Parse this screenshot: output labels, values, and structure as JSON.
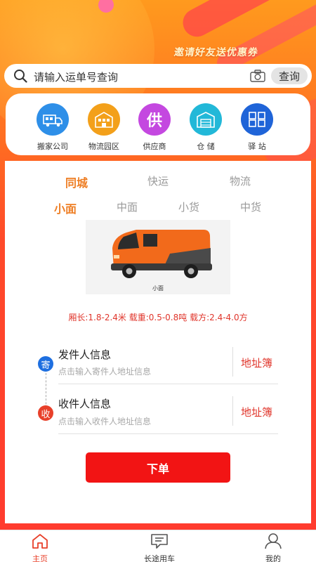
{
  "promo": {
    "text": "邀请好友送优惠券"
  },
  "search": {
    "placeholder": "请输入运单号查询",
    "button": "查询"
  },
  "categories": [
    {
      "label": "搬家公司",
      "icon": "moving-truck-icon",
      "color": "#2e8fe8"
    },
    {
      "label": "物流园区",
      "icon": "warehouse-building-icon",
      "color": "#f3a01a"
    },
    {
      "label": "供应商",
      "icon": "supplier-icon",
      "color": "#c448e0"
    },
    {
      "label": "仓 储",
      "icon": "storage-icon",
      "color": "#22b8d8"
    },
    {
      "label": "驿 站",
      "icon": "station-icon",
      "color": "#1f64d8"
    }
  ],
  "service_tabs": [
    {
      "label": "同城",
      "active": true
    },
    {
      "label": "快运",
      "active": false
    },
    {
      "label": "物流",
      "active": false
    }
  ],
  "vehicle_tabs": [
    {
      "label": "小面",
      "active": true
    },
    {
      "label": "中面",
      "active": false
    },
    {
      "label": "小货",
      "active": false
    },
    {
      "label": "中货",
      "active": false
    }
  ],
  "vehicle": {
    "caption": "小面",
    "color": "#f26a1b"
  },
  "specs": {
    "text": "厢长:1.8-2.4米  载重:0.5-0.8吨  载方:2.4-4.0方"
  },
  "sender": {
    "badge": "寄",
    "title": "发件人信息",
    "hint": "点击输入寄件人地址信息",
    "link": "地址簿",
    "badge_color": "#1e6fe0"
  },
  "receiver": {
    "badge": "收",
    "title": "收件人信息",
    "hint": "点击输入收件人地址信息",
    "link": "地址簿",
    "badge_color": "#e8402a"
  },
  "order_button": {
    "label": "下单"
  },
  "tabbar": [
    {
      "label": "主页",
      "icon": "home-icon",
      "active": true
    },
    {
      "label": "长途用车",
      "icon": "message-icon",
      "active": false
    },
    {
      "label": "我的",
      "icon": "user-icon",
      "active": false
    }
  ],
  "colors": {
    "accent": "#ee7e24",
    "danger": "#e0352b",
    "order": "#f21414"
  }
}
